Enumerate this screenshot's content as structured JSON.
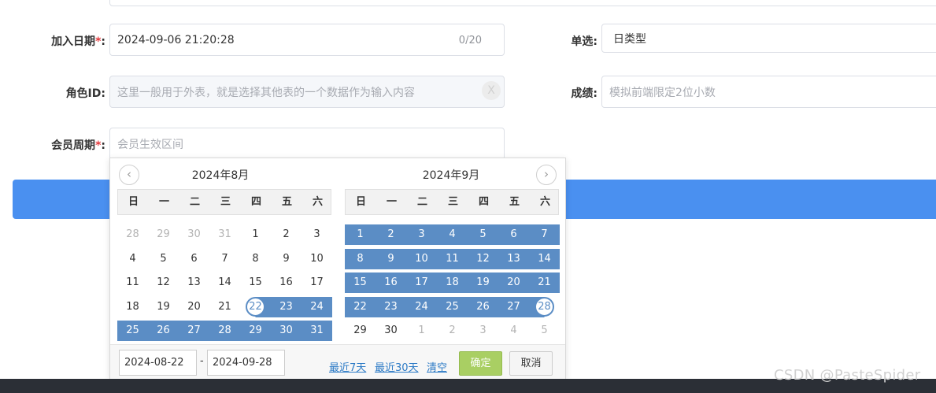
{
  "form": {
    "join_date": {
      "label": "加入日期",
      "required_mark": "*",
      "colon": ":",
      "value": "2024-09-06 21:20:28",
      "counter": "0/20"
    },
    "single_choice": {
      "label": "单选:",
      "value": "日类型"
    },
    "role_id": {
      "label": "角色ID:",
      "placeholder": "这里一般用于外表，就是选择其他表的一个数据作为输入内容",
      "clear_icon": "X"
    },
    "score": {
      "label": "成绩:",
      "placeholder": "模拟前端限定2位小数"
    },
    "member_period": {
      "label": "会员周期",
      "required_mark": "*",
      "colon": ":",
      "placeholder": "会员生效区间"
    }
  },
  "datepicker": {
    "prev_icon": "‹",
    "next_icon": "›",
    "left_title": "2024年8月",
    "right_title": "2024年9月",
    "weekdays": [
      "日",
      "一",
      "二",
      "三",
      "四",
      "五",
      "六"
    ],
    "left_days": [
      {
        "d": "28",
        "s": "other"
      },
      {
        "d": "29",
        "s": "other"
      },
      {
        "d": "30",
        "s": "other"
      },
      {
        "d": "31",
        "s": "other"
      },
      {
        "d": "1",
        "s": ""
      },
      {
        "d": "2",
        "s": ""
      },
      {
        "d": "3",
        "s": ""
      },
      {
        "d": "4",
        "s": ""
      },
      {
        "d": "5",
        "s": ""
      },
      {
        "d": "6",
        "s": ""
      },
      {
        "d": "7",
        "s": ""
      },
      {
        "d": "8",
        "s": ""
      },
      {
        "d": "9",
        "s": ""
      },
      {
        "d": "10",
        "s": ""
      },
      {
        "d": "11",
        "s": ""
      },
      {
        "d": "12",
        "s": ""
      },
      {
        "d": "13",
        "s": ""
      },
      {
        "d": "14",
        "s": ""
      },
      {
        "d": "15",
        "s": ""
      },
      {
        "d": "16",
        "s": ""
      },
      {
        "d": "17",
        "s": ""
      },
      {
        "d": "18",
        "s": ""
      },
      {
        "d": "19",
        "s": ""
      },
      {
        "d": "20",
        "s": ""
      },
      {
        "d": "21",
        "s": ""
      },
      {
        "d": "22",
        "s": "start"
      },
      {
        "d": "23",
        "s": "range"
      },
      {
        "d": "24",
        "s": "range"
      },
      {
        "d": "25",
        "s": "range"
      },
      {
        "d": "26",
        "s": "range"
      },
      {
        "d": "27",
        "s": "range"
      },
      {
        "d": "28",
        "s": "range"
      },
      {
        "d": "29",
        "s": "range"
      },
      {
        "d": "30",
        "s": "range"
      },
      {
        "d": "31",
        "s": "range"
      }
    ],
    "right_days": [
      {
        "d": "1",
        "s": "range"
      },
      {
        "d": "2",
        "s": "range"
      },
      {
        "d": "3",
        "s": "range"
      },
      {
        "d": "4",
        "s": "range"
      },
      {
        "d": "5",
        "s": "range"
      },
      {
        "d": "6",
        "s": "range"
      },
      {
        "d": "7",
        "s": "range"
      },
      {
        "d": "8",
        "s": "range"
      },
      {
        "d": "9",
        "s": "range"
      },
      {
        "d": "10",
        "s": "range"
      },
      {
        "d": "11",
        "s": "range"
      },
      {
        "d": "12",
        "s": "range"
      },
      {
        "d": "13",
        "s": "range"
      },
      {
        "d": "14",
        "s": "range"
      },
      {
        "d": "15",
        "s": "range"
      },
      {
        "d": "16",
        "s": "range"
      },
      {
        "d": "17",
        "s": "range"
      },
      {
        "d": "18",
        "s": "range"
      },
      {
        "d": "19",
        "s": "range"
      },
      {
        "d": "20",
        "s": "range"
      },
      {
        "d": "21",
        "s": "range"
      },
      {
        "d": "22",
        "s": "range"
      },
      {
        "d": "23",
        "s": "range"
      },
      {
        "d": "24",
        "s": "range"
      },
      {
        "d": "25",
        "s": "range"
      },
      {
        "d": "26",
        "s": "range"
      },
      {
        "d": "27",
        "s": "range"
      },
      {
        "d": "28",
        "s": "end"
      },
      {
        "d": "29",
        "s": ""
      },
      {
        "d": "30",
        "s": ""
      },
      {
        "d": "1",
        "s": "other"
      },
      {
        "d": "2",
        "s": "other"
      },
      {
        "d": "3",
        "s": "other"
      },
      {
        "d": "4",
        "s": "other"
      },
      {
        "d": "5",
        "s": "other"
      }
    ],
    "start_value": "2024-08-22",
    "separator": "-",
    "end_value": "2024-09-28",
    "quick_7": "最近7天",
    "quick_30": "最近30天",
    "clear": "清空",
    "confirm": "确定",
    "cancel": "取消",
    "colors": {
      "range": "#5b8dc5",
      "confirm": "#a9cf63",
      "link": "#2d7bc6"
    }
  },
  "watermark": "CSDN @PasteSpider"
}
